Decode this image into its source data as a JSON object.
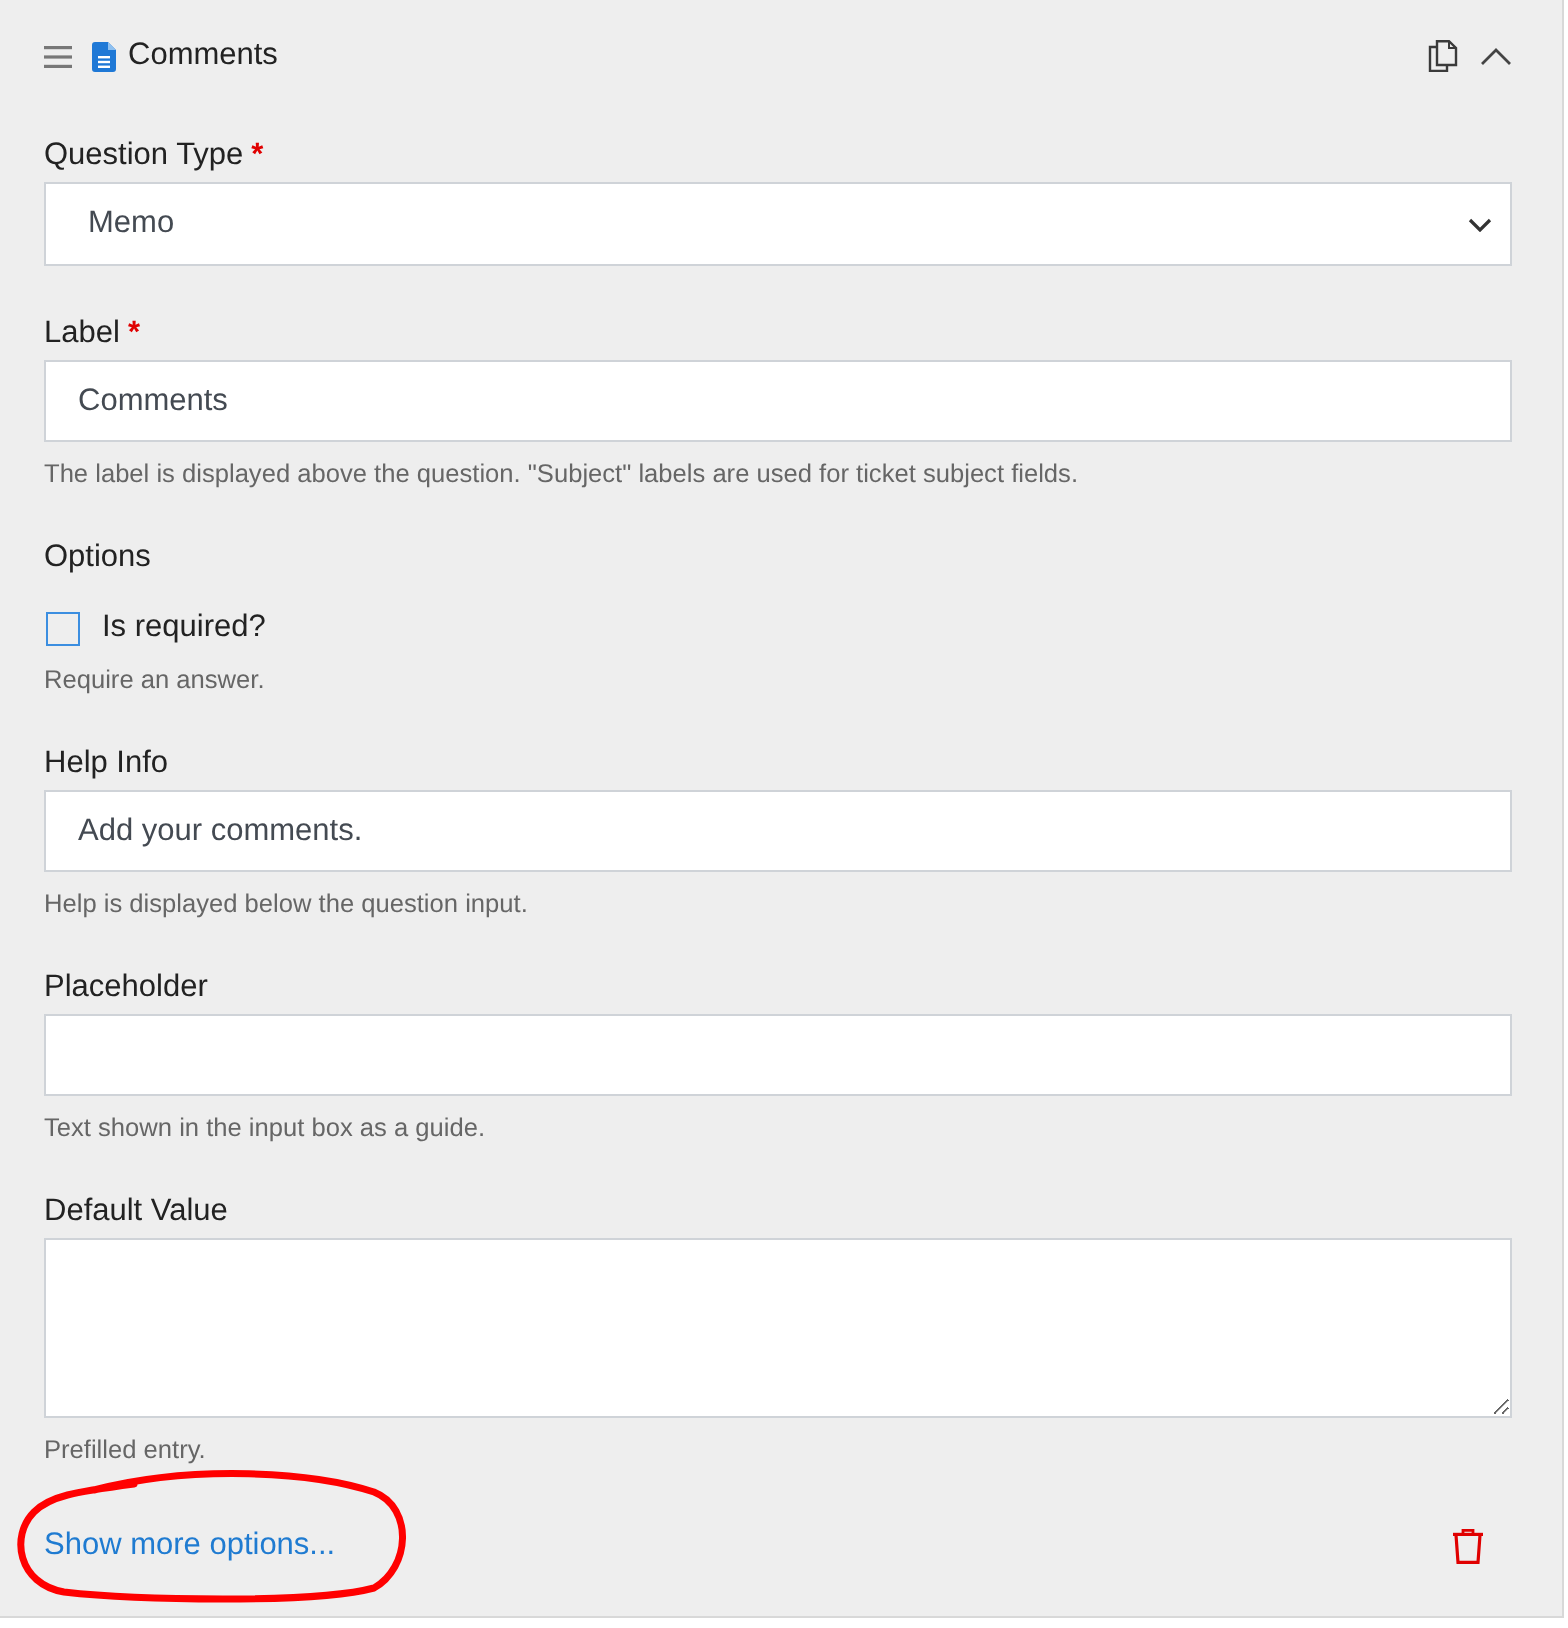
{
  "header": {
    "title": "Comments"
  },
  "required_mark": "*",
  "fields": [
    {
      "kind": "select",
      "label": "Question Type",
      "required": true,
      "value": "Memo"
    },
    {
      "kind": "text",
      "label": "Label",
      "required": true,
      "value": "Comments",
      "hint": "The label is displayed above the question. \"Subject\" labels are used for ticket subject fields."
    },
    {
      "kind": "checkbox",
      "label": "Options",
      "required": false,
      "option": "Is required?",
      "checked": false,
      "hint": "Require an answer."
    },
    {
      "kind": "text",
      "label": "Help Info",
      "required": false,
      "value": "Add your comments.",
      "hint": "Help is displayed below the question input."
    },
    {
      "kind": "text",
      "label": "Placeholder",
      "required": false,
      "hint": "Text shown in the input box as a guide."
    },
    {
      "kind": "textarea",
      "label": "Default Value",
      "required": false,
      "hint": "Prefilled entry."
    }
  ],
  "footer": {
    "link": "Show more options..."
  }
}
